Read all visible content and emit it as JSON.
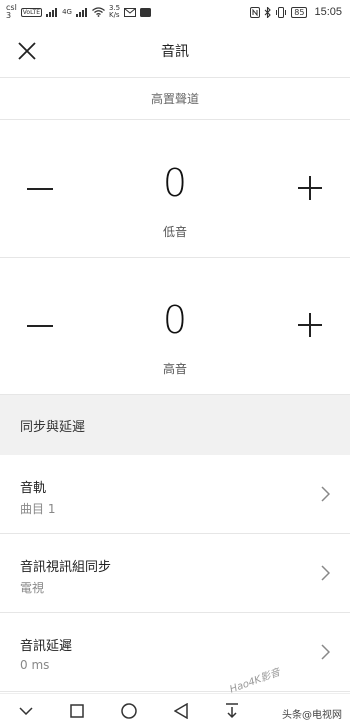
{
  "status_bar": {
    "carrier": "csl",
    "carrier_sub": "3",
    "chip": "VoLTE",
    "signal": "4G",
    "speed_value": "3.5",
    "speed_unit": "K/s",
    "battery": "85",
    "time": "15:05"
  },
  "header": {
    "title": "音訊"
  },
  "section_label": "高置聲道",
  "bass": {
    "value": "0",
    "label": "低音"
  },
  "treble": {
    "value": "0",
    "label": "高音"
  },
  "sync_group": {
    "title": "同步與延遲",
    "items": [
      {
        "title": "音軌",
        "subtitle": "曲目 1"
      },
      {
        "title": "音訊視訊組同步",
        "subtitle": "電視"
      },
      {
        "title": "音訊延遲",
        "subtitle": "0 ms"
      }
    ]
  },
  "watermark": "Hao4K影音",
  "watermark_source": "头条@电视网",
  "colors": {
    "divider": "#e6e6e6",
    "group_bg": "#f1f1f1",
    "text": "#222222",
    "subtext": "#888888"
  },
  "icons": [
    "close-icon",
    "minus-icon",
    "plus-icon",
    "chevron-right-icon",
    "nav-down-icon",
    "nav-square-icon",
    "nav-home-icon",
    "nav-back-icon",
    "nav-download-icon"
  ]
}
